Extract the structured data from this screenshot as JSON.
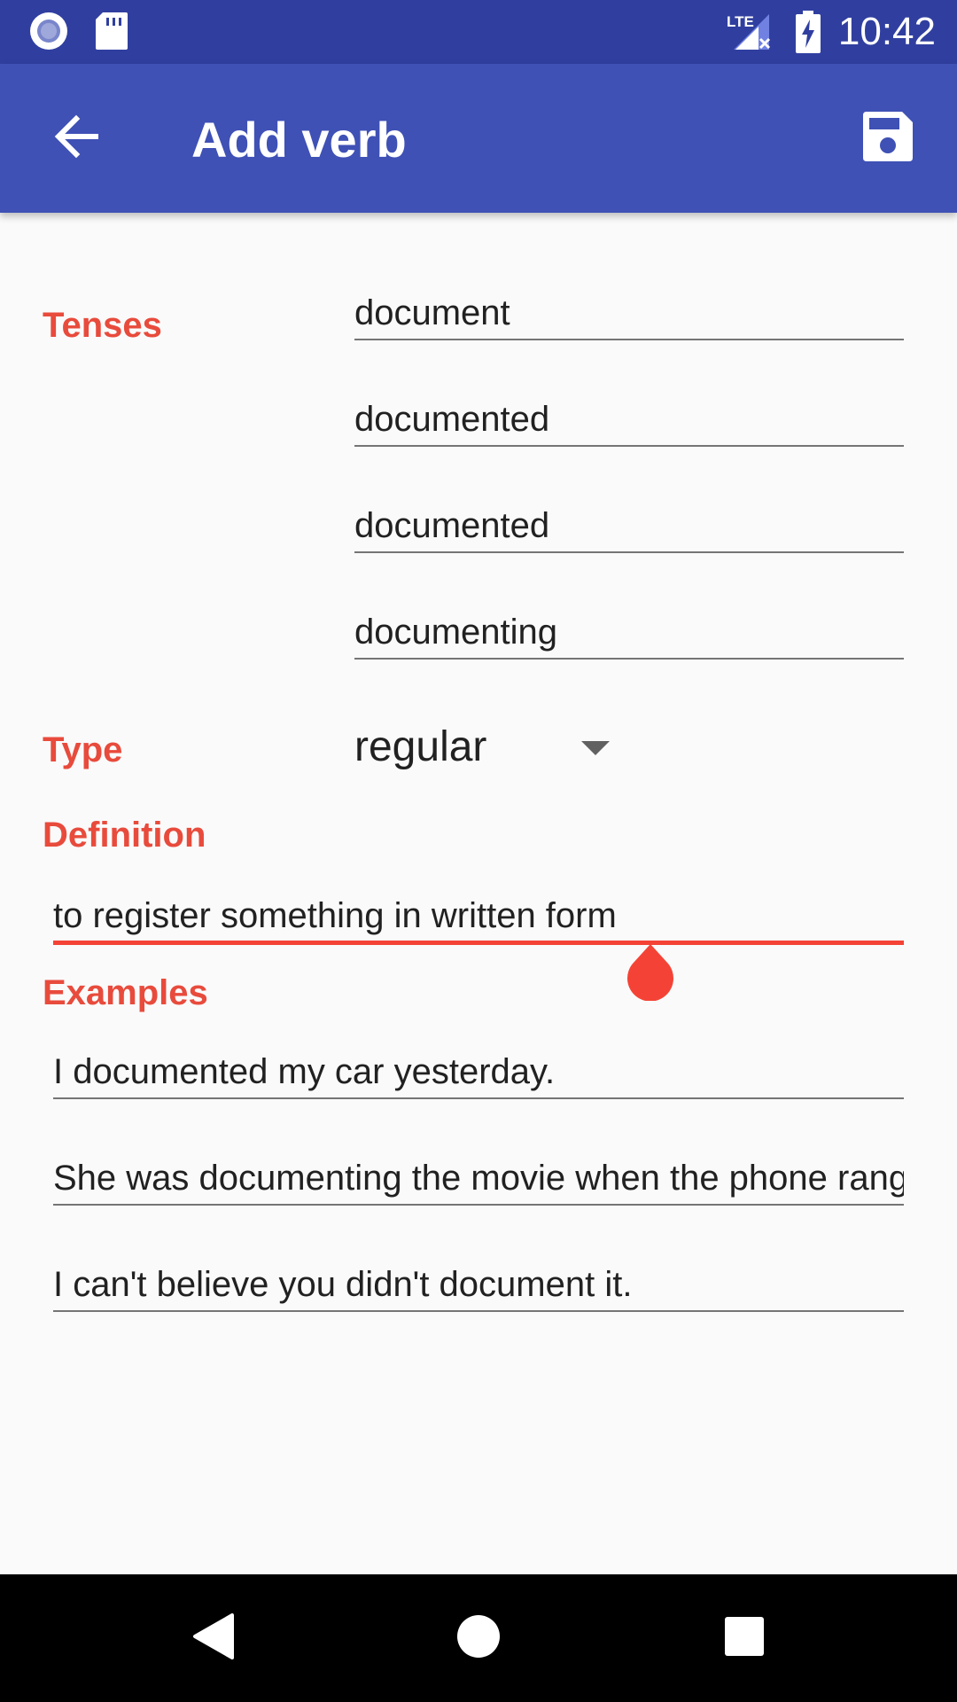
{
  "status_bar": {
    "time": "10:42",
    "network": "LTE"
  },
  "app_bar": {
    "title": "Add verb"
  },
  "tenses": {
    "label": "Tenses",
    "values": [
      "document",
      "documented",
      "documented",
      "documenting"
    ]
  },
  "type": {
    "label": "Type",
    "selected": "regular"
  },
  "definition": {
    "label": "Definition",
    "value": "to register something in written form"
  },
  "examples": {
    "label": "Examples",
    "values": [
      "I documented my car yesterday.",
      "She was documenting the movie when the phone rang",
      "I can't believe you didn't document it."
    ]
  },
  "colors": {
    "status_bar": "#303f9f",
    "app_bar": "#3f51b5",
    "accent": "#e84b3c",
    "cursor": "#f44336",
    "background": "#fafafa"
  }
}
